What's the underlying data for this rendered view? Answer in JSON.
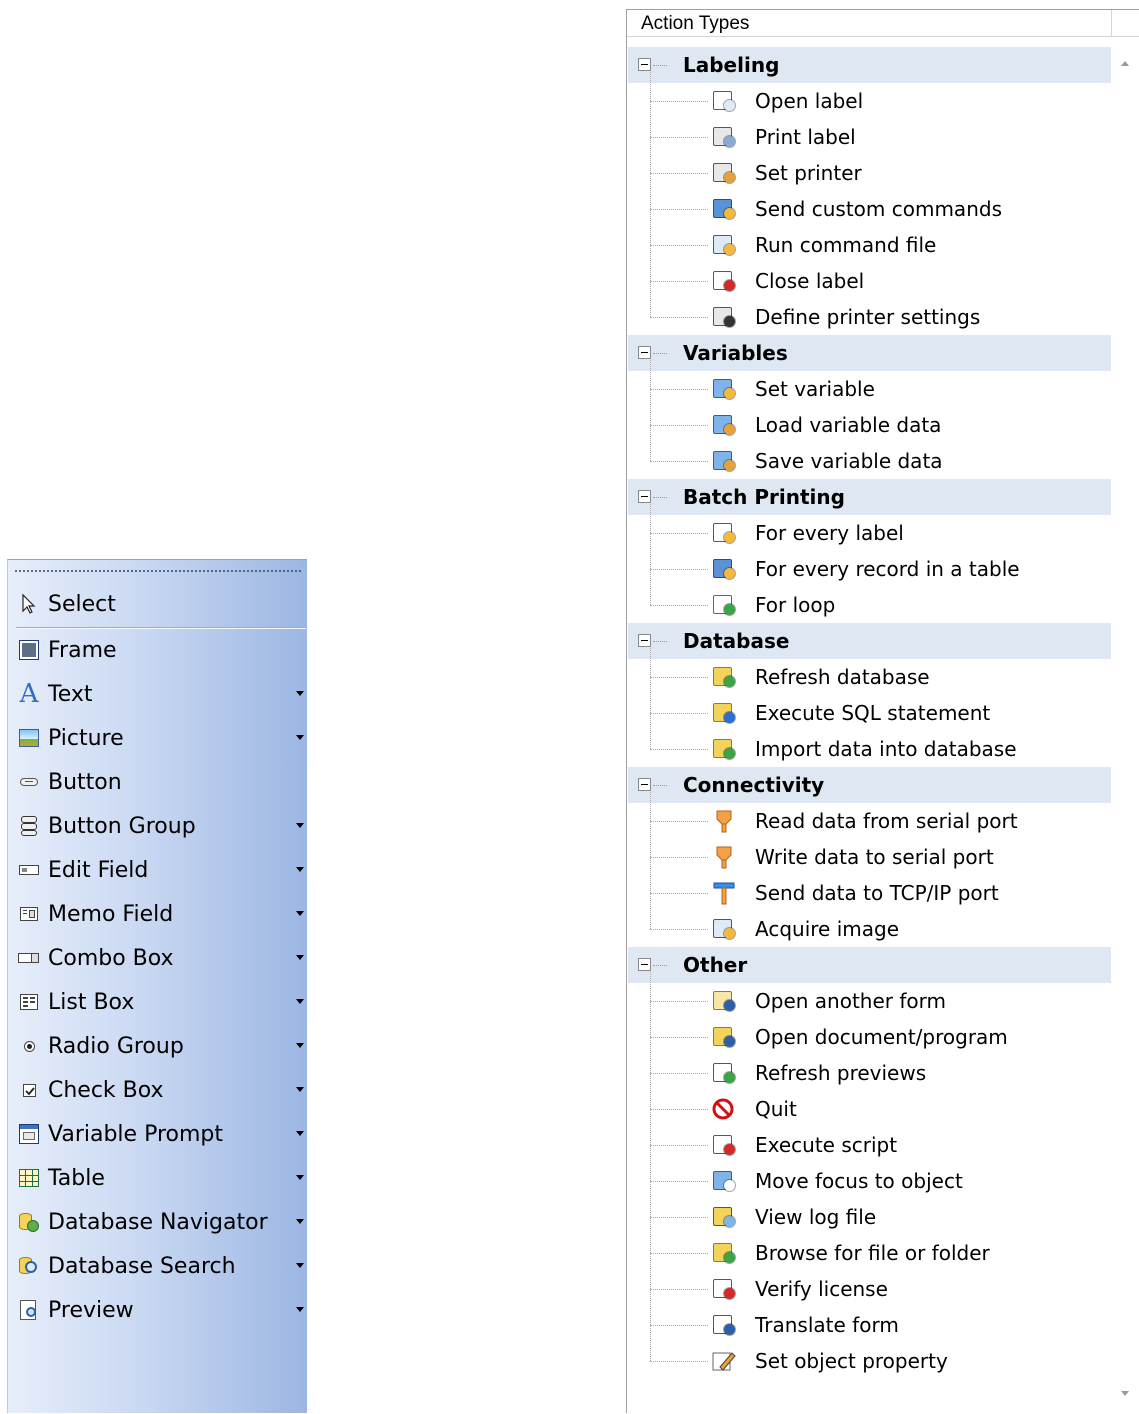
{
  "toolbox": {
    "items": [
      {
        "label": "Select",
        "icon": "cursor-arrow-icon",
        "dropdown": false
      },
      {
        "label": "Frame",
        "icon": "frame-icon",
        "dropdown": false
      },
      {
        "label": "Text",
        "icon": "text-a-icon",
        "dropdown": true
      },
      {
        "label": "Picture",
        "icon": "picture-icon",
        "dropdown": true
      },
      {
        "label": "Button",
        "icon": "button-icon",
        "dropdown": false
      },
      {
        "label": "Button Group",
        "icon": "button-group-icon",
        "dropdown": true
      },
      {
        "label": "Edit Field",
        "icon": "edit-field-icon",
        "dropdown": true
      },
      {
        "label": "Memo Field",
        "icon": "memo-field-icon",
        "dropdown": true
      },
      {
        "label": "Combo Box",
        "icon": "combo-box-icon",
        "dropdown": true
      },
      {
        "label": "List Box",
        "icon": "list-box-icon",
        "dropdown": true
      },
      {
        "label": "Radio Group",
        "icon": "radio-group-icon",
        "dropdown": true
      },
      {
        "label": "Check Box",
        "icon": "check-box-icon",
        "dropdown": true
      },
      {
        "label": "Variable Prompt",
        "icon": "variable-prompt-icon",
        "dropdown": true
      },
      {
        "label": "Table",
        "icon": "table-icon",
        "dropdown": true
      },
      {
        "label": "Database Navigator",
        "icon": "database-navigator-icon",
        "dropdown": true
      },
      {
        "label": "Database Search",
        "icon": "database-search-icon",
        "dropdown": true
      },
      {
        "label": "Preview",
        "icon": "preview-icon",
        "dropdown": true
      }
    ]
  },
  "panel": {
    "header": "Action Types",
    "categories": [
      {
        "label": "Labeling",
        "items": [
          {
            "label": "Open label",
            "icon": "open-label-icon"
          },
          {
            "label": "Print label",
            "icon": "print-label-icon"
          },
          {
            "label": "Set printer",
            "icon": "set-printer-icon"
          },
          {
            "label": "Send custom commands",
            "icon": "send-custom-commands-icon"
          },
          {
            "label": "Run command file",
            "icon": "run-command-file-icon"
          },
          {
            "label": "Close label",
            "icon": "close-label-icon"
          },
          {
            "label": "Define printer settings",
            "icon": "define-printer-settings-icon"
          }
        ]
      },
      {
        "label": "Variables",
        "items": [
          {
            "label": "Set variable",
            "icon": "set-variable-icon"
          },
          {
            "label": "Load variable data",
            "icon": "load-variable-data-icon"
          },
          {
            "label": "Save variable data",
            "icon": "save-variable-data-icon"
          }
        ]
      },
      {
        "label": "Batch Printing",
        "items": [
          {
            "label": "For every label",
            "icon": "for-every-label-icon"
          },
          {
            "label": "For every record in a table",
            "icon": "for-every-record-icon"
          },
          {
            "label": "For loop",
            "icon": "for-loop-icon"
          }
        ]
      },
      {
        "label": "Database",
        "items": [
          {
            "label": "Refresh database",
            "icon": "refresh-database-icon"
          },
          {
            "label": "Execute SQL statement",
            "icon": "execute-sql-icon"
          },
          {
            "label": "Import data into database",
            "icon": "import-data-icon"
          }
        ]
      },
      {
        "label": "Connectivity",
        "items": [
          {
            "label": "Read data from serial port",
            "icon": "read-serial-port-icon"
          },
          {
            "label": "Write data to serial port",
            "icon": "write-serial-port-icon"
          },
          {
            "label": "Send data to TCP/IP port",
            "icon": "tcp-ip-port-icon"
          },
          {
            "label": "Acquire image",
            "icon": "acquire-image-icon"
          }
        ]
      },
      {
        "label": "Other",
        "items": [
          {
            "label": "Open another form",
            "icon": "open-form-icon"
          },
          {
            "label": "Open document/program",
            "icon": "open-document-icon"
          },
          {
            "label": "Refresh previews",
            "icon": "refresh-previews-icon"
          },
          {
            "label": "Quit",
            "icon": "quit-icon"
          },
          {
            "label": "Execute script",
            "icon": "execute-script-icon"
          },
          {
            "label": "Move focus to object",
            "icon": "move-focus-icon"
          },
          {
            "label": "View log file",
            "icon": "view-log-file-icon"
          },
          {
            "label": "Browse for file or folder",
            "icon": "browse-folder-icon"
          },
          {
            "label": "Verify license",
            "icon": "verify-license-icon"
          },
          {
            "label": "Translate form",
            "icon": "translate-form-icon"
          },
          {
            "label": "Set object property",
            "icon": "set-object-property-icon"
          }
        ]
      }
    ]
  }
}
